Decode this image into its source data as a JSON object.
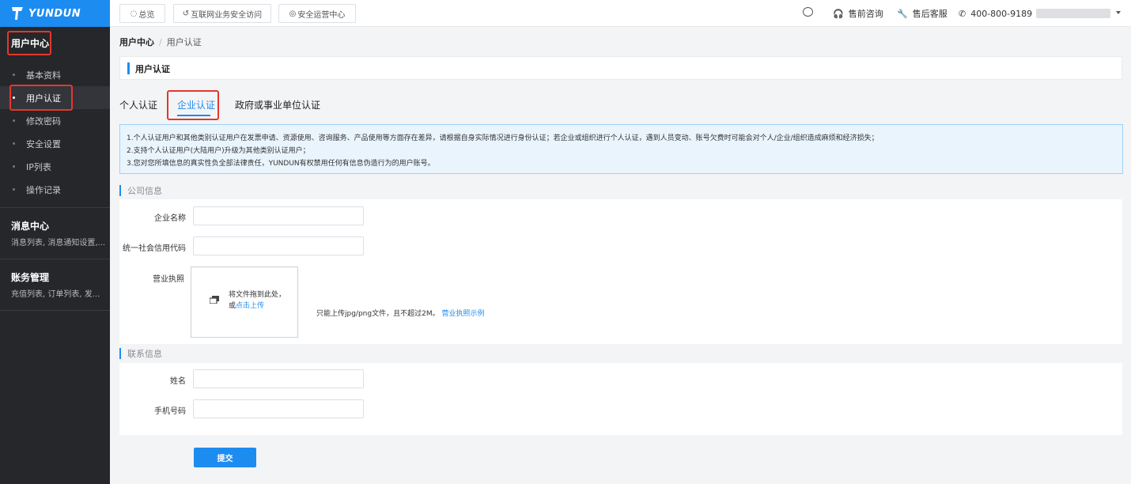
{
  "brand": {
    "name": "YUNDUN",
    "color": "#1d8cf0"
  },
  "sidebar": {
    "user_center": {
      "title": "用户中心",
      "items": [
        {
          "label": "基本资料"
        },
        {
          "label": "用户认证"
        },
        {
          "label": "修改密码"
        },
        {
          "label": "安全设置"
        },
        {
          "label": "IP列表"
        },
        {
          "label": "操作记录"
        }
      ]
    },
    "message_center": {
      "title": "消息中心",
      "sub": "消息列表, 消息通知设置,..."
    },
    "billing": {
      "title": "账务管理",
      "sub": "充值列表, 订单列表, 发..."
    }
  },
  "topbar": {
    "tabs": [
      {
        "label": "总览",
        "icon": "dashboard-icon"
      },
      {
        "label": "互联网业务安全访问",
        "icon": "link-icon"
      },
      {
        "label": "安全运营中心",
        "icon": "shield-icon"
      }
    ],
    "presale": "售前咨询",
    "aftersale": "售后客服",
    "phone": "400-800-9189"
  },
  "breadcrumb": {
    "root": "用户中心",
    "sep": "/",
    "current": "用户认证"
  },
  "page_title": "用户认证",
  "tabs": [
    {
      "label": "个人认证"
    },
    {
      "label": "企业认证"
    },
    {
      "label": "政府或事业单位认证"
    }
  ],
  "notice": [
    "1.个人认证用户和其他类别认证用户在发票申请、资源使用、咨询服务、产品使用等方面存在差异，请根据自身实际情况进行身份认证；若企业或组织进行个人认证，遇到人员变动、账号欠费时可能会对个人/企业/组织造成麻烦和经济损失；",
    "2.支持个人认证用户(大陆用户)升级为其他类别认证用户；",
    "3.您对您所填信息的真实性负全部法律责任，YUNDUN有权禁用任何有信息伪造行为的用户账号。"
  ],
  "company_section": {
    "title": "公司信息",
    "company_name_label": "企业名称",
    "credit_code_label": "统一社会信用代码",
    "license_label": "营业执照",
    "upload_text": "将文件拖到此处，或",
    "upload_link": "点击上传",
    "hint": "只能上传jpg/png文件，且不超过2M。",
    "sample_link": "营业执照示例"
  },
  "contact_section": {
    "title": "联系信息",
    "name_label": "姓名",
    "phone_label": "手机号码"
  },
  "submit_label": "提交"
}
